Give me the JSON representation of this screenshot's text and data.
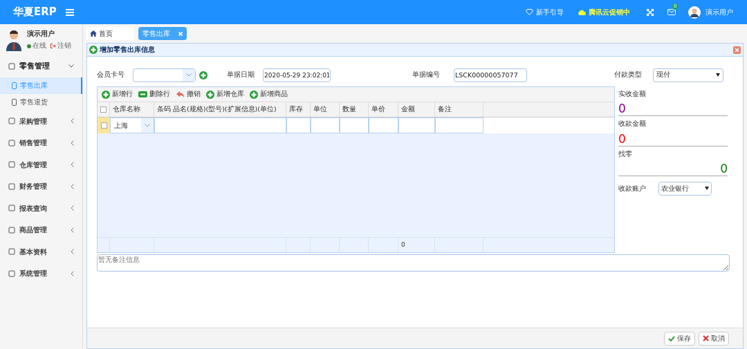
{
  "header": {
    "logo": "华夏ERP",
    "links": [
      {
        "kind": "guide",
        "label": "新手引导"
      },
      {
        "kind": "promo",
        "label": "腾讯云促销中"
      }
    ],
    "mail_badge": "0",
    "user": "演示用户"
  },
  "sidebar": {
    "user": {
      "name": "演示用户",
      "status": "在线",
      "logout": "注销"
    },
    "items": [
      {
        "label": "零售管理",
        "expanded": true,
        "children": [
          {
            "label": "零售出库",
            "selected": true
          },
          {
            "label": "零售退货",
            "selected": false
          }
        ]
      },
      {
        "label": "采购管理",
        "expanded": false
      },
      {
        "label": "销售管理",
        "expanded": false
      },
      {
        "label": "仓库管理",
        "expanded": false
      },
      {
        "label": "财务管理",
        "expanded": false
      },
      {
        "label": "报表查询",
        "expanded": false
      },
      {
        "label": "商品管理",
        "expanded": false
      },
      {
        "label": "基本资料",
        "expanded": false
      },
      {
        "label": "系统管理",
        "expanded": false
      }
    ]
  },
  "tabs": [
    {
      "label": "首页",
      "selected": false,
      "closable": false
    },
    {
      "label": "零售出库",
      "selected": true,
      "closable": true
    }
  ],
  "panel": {
    "title": "增加零售出库信息",
    "form": {
      "member_label": "会员卡号",
      "date_label": "单据日期",
      "date_value": "2020-05-29 23:02:01",
      "number_label": "单据编号",
      "number_value": "LSCK00000057077",
      "pay_label": "付款类型",
      "pay_value": "现付"
    },
    "toolbar": [
      "新增行",
      "删除行",
      "撤销",
      "新增仓库",
      "新增商品"
    ],
    "table": {
      "columns": [
        "仓库名称",
        "条码 品名(规格)(型号)(扩展信息)(单位)",
        "库存",
        "单位",
        "数量",
        "单价",
        "金额",
        "备注"
      ],
      "header_checked": false,
      "rows": [
        {
          "warehouse": "上海",
          "checked": false
        }
      ],
      "footer_total": "0"
    },
    "summary": [
      {
        "kind": "amount",
        "label": "实收金额",
        "value": "0",
        "color": "#800080"
      },
      {
        "kind": "amount",
        "label": "收款金额",
        "value": "0",
        "color": "#ff0000"
      },
      {
        "kind": "change",
        "label": "找零",
        "value": "0",
        "color": "#008000"
      }
    ],
    "account": {
      "label": "收款账户",
      "value": "农业银行"
    },
    "remark": {
      "placeholder": "暂无备注信息"
    },
    "buttons": [
      "保存",
      "取消"
    ]
  }
}
